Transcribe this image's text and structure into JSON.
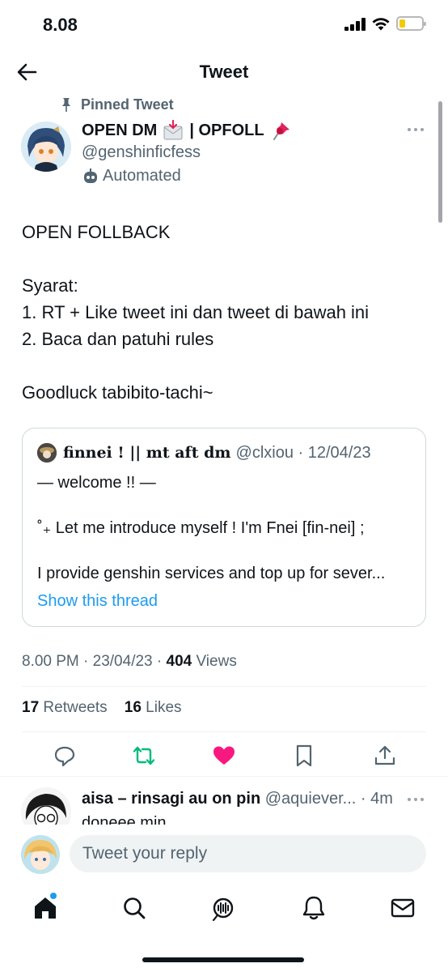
{
  "status_bar": {
    "time": "8.08"
  },
  "header": {
    "title": "Tweet"
  },
  "tweet": {
    "pinned_label": "Pinned Tweet",
    "author_name": "OPEN DM",
    "author_name_part2": "| OPFOLL",
    "author_handle": "@genshinficfess",
    "automated_label": "Automated",
    "body": [
      "OPEN FOLLBACK",
      "",
      "Syarat:",
      "1. RT + Like tweet ini dan tweet di bawah ini",
      "2. Baca dan patuhi rules",
      "",
      "Goodluck tabibito-tachi~"
    ],
    "quote": {
      "name": "finnei ! || mt aft dm",
      "handle_date": "@clxiou · 12/04/23",
      "lines": [
        "— welcome !! —",
        "˚₊ Let me introduce myself ! I'm Fnei [fin-nei] ;",
        "I provide genshin services and top up for sever..."
      ],
      "show_thread": "Show this thread"
    },
    "timestamp": "8.00 PM · 23/04/23 · ",
    "views_count": "404",
    "views_label": " Views",
    "retweets_count": "17",
    "retweets_label": "Retweets",
    "likes_count": "16",
    "likes_label": "Likes",
    "liked": true,
    "colors": {
      "like": "#f91880",
      "retweet": "#00ba7c",
      "link": "#1d9bf0",
      "icon": "#536471"
    }
  },
  "reply": {
    "name": "aisa – rinsagi au on pin",
    "handle_time": "@aquiever... · 4m",
    "text": "doneee min"
  },
  "compose": {
    "placeholder": "Tweet your reply"
  },
  "bottom_nav": {
    "items": [
      "home-icon",
      "search-icon",
      "spaces-icon",
      "notifications-icon",
      "messages-icon"
    ]
  }
}
